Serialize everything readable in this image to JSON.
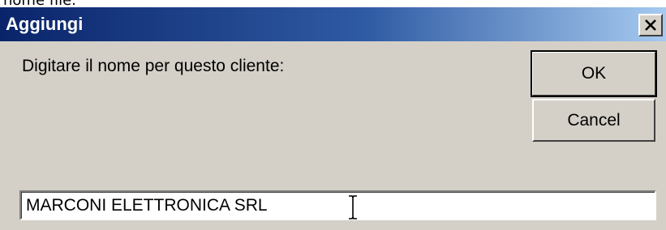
{
  "background_fragment": "nome file.",
  "dialog": {
    "title": "Aggiungi",
    "prompt": "Digitare il nome per questo cliente:",
    "ok_label": "OK",
    "cancel_label": "Cancel",
    "name_value": "MARCONI ELETTRONICA SRL",
    "close_icon": "close-icon",
    "cursor_icon": "text-ibeam-cursor-icon"
  },
  "colors": {
    "title_gradient_start": "#0a246a",
    "title_gradient_end": "#a6caf0",
    "dialog_face": "#d4d0c8"
  }
}
